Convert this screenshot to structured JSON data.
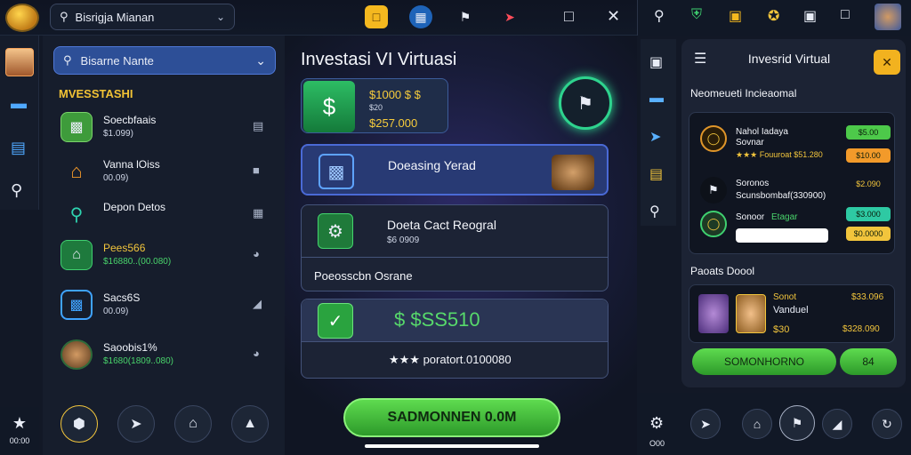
{
  "topbar": {
    "brand_text": "",
    "app_select_value": "Bisrigja Mianan",
    "icons": [
      "folder-icon",
      "app-grid-icon",
      "building-icon",
      "rocket-icon",
      "square-icon",
      "close-icon"
    ]
  },
  "left_rail": {
    "bottom_time": "00:00"
  },
  "side_panel": {
    "search_value": "Bisarne Nante",
    "section_title": "MVESSTASHI",
    "items": [
      {
        "title": "Soecbfaais",
        "sub": "$1.099)"
      },
      {
        "title": "Vanna lOiss",
        "sub": "00.09)"
      },
      {
        "title": "Depon Detos",
        "sub": ""
      },
      {
        "title": "Pees566",
        "sub": "$16880..(00.080)"
      },
      {
        "title": "Sacs6S",
        "sub": "00.09)"
      },
      {
        "title": "Saoobis1%",
        "sub": "$1680(1809..080)"
      }
    ]
  },
  "main": {
    "title": "Investasi VI Virtuasi",
    "balance_line1": "$1000 $ $",
    "balance_line2": "$20",
    "balance_line3": "$257.000",
    "card_a_title": "Doeasing Yerad",
    "card_b_title": "Doeta Cact Reogral",
    "card_b_sub": "$6 0909",
    "card_b_section": "Poeosscbn Osrane",
    "card_c_value": "$ $SS510",
    "card_c_tally": "★★★ poratort.0100080",
    "cta": "SADMONNEN 0.0M"
  },
  "right_panel": {
    "title": "Invesrid Virtual",
    "section1": "Neomeueti Incieaomal",
    "offers": [
      {
        "title": "Nahol Iadaya",
        "sub2": "Sovnar",
        "value": "★★★ Fouuroat $51.280",
        "pill1": "$5.00",
        "pill2": "$10.00"
      },
      {
        "title": "Soronos",
        "sub2": "",
        "value": "Scunsbombaf(330900)",
        "pill1": "$2.090",
        "pill2": ""
      },
      {
        "title": "Sonoor",
        "sub2": "Etagar",
        "value": "",
        "pill1": "$3.000",
        "pill2": "$0.0000"
      }
    ],
    "section2": "Paoats Doool",
    "reward": {
      "name": "Sonot",
      "sub": "Vanduel",
      "amt": "$30",
      "v1": "$33.096",
      "v2": "$328.090"
    },
    "btn_a": "SOMONHORNO",
    "btn_b": "84"
  },
  "right_bottom": {
    "label": "O00"
  },
  "colors": {
    "accent": "#4f78d6",
    "green": "#3fbf48",
    "gold": "#f2c53c"
  }
}
